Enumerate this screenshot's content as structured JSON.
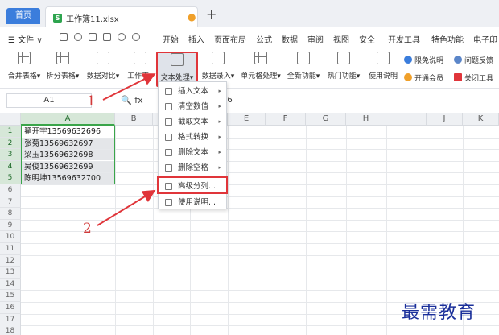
{
  "tabs": {
    "home": "首页",
    "doc_icon": "S",
    "doc_name": "工作簿11.xlsx",
    "modified_dot": "●",
    "new_tab": "+"
  },
  "menubar": {
    "file": "☰ 文件 ∨",
    "items": [
      "开始",
      "插入",
      "页面布局",
      "公式",
      "数据",
      "审阅",
      "视图",
      "安全",
      "开发工具",
      "特色功能",
      "电子印"
    ]
  },
  "ribbon": {
    "buttons": [
      "合并表格▾",
      "拆分表格▾",
      "数据对比▾",
      "工作表▾",
      "文本处理▾",
      "数据录入▾",
      "单元格处理▾",
      "全新功能▾",
      "热门功能▾",
      "使用说明"
    ],
    "right": [
      "限免说明",
      "问题反馈",
      "开通会员",
      "关闭工具"
    ]
  },
  "formula_bar": {
    "name_box": "A1",
    "icons": "🔍 fx",
    "value": "96"
  },
  "grid": {
    "columns": [
      "A",
      "B",
      "C",
      "D",
      "E",
      "F",
      "G",
      "H",
      "I",
      "J",
      "K"
    ],
    "rows": [
      "1",
      "2",
      "3",
      "4",
      "5",
      "6",
      "7",
      "8",
      "9",
      "10",
      "11",
      "12",
      "13",
      "14",
      "15",
      "16",
      "17",
      "18"
    ],
    "cells": [
      "翟开宇13569632696",
      "张菊13569632697",
      "梁玉13569632698",
      "吴俊13569632699",
      "陈明坤13569632700"
    ]
  },
  "dropdown": {
    "items": [
      "插入文本",
      "清空数值",
      "截取文本",
      "格式转换",
      "删除文本",
      "删除空格",
      "高级分列...",
      "使用说明..."
    ],
    "arrow": "▸"
  },
  "annotations": {
    "step1": "1",
    "step2": "2",
    "watermark": "最需教育"
  },
  "colors": {
    "accent_red": "#e0353a",
    "select_green": "#3aa54a",
    "tab_blue": "#3b7ddc",
    "watermark_blue": "#1a2f9a"
  }
}
